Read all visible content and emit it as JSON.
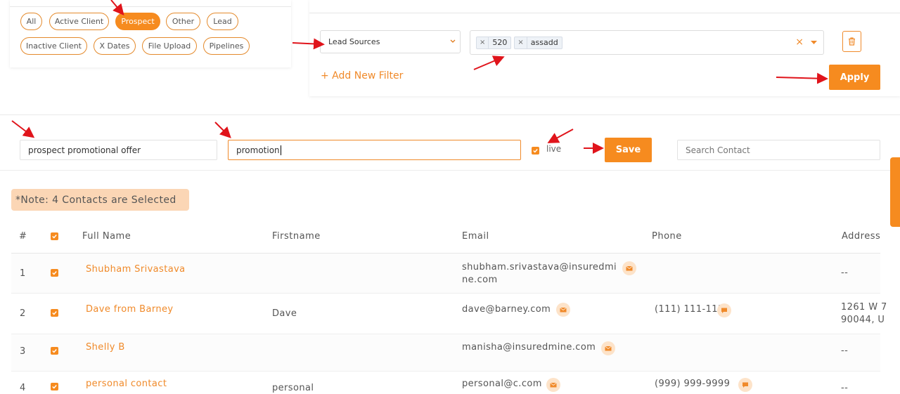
{
  "chips": [
    "All",
    "Active Client",
    "Prospect",
    "Other",
    "Lead",
    "Inactive Client",
    "X Dates",
    "File Upload",
    "Pipelines"
  ],
  "filter": {
    "field_label": "Lead Sources",
    "tags": [
      "520",
      "assadd"
    ],
    "tag_remove_glyph": "×",
    "clear_glyph": "×",
    "add_filter_label": "+ Add New Filter",
    "apply_label": "Apply"
  },
  "save_bar": {
    "name_value": "prospect promotional offer",
    "description_value": "promotion",
    "live_label": "live",
    "save_label": "Save",
    "search_placeholder": "Search Contact"
  },
  "note": "*Note: 4 Contacts are Selected",
  "table": {
    "headers": [
      "#",
      "Full Name",
      "Firstname",
      "Email",
      "Phone",
      "Address"
    ],
    "rows": [
      {
        "num": "1",
        "full_name": "Shubham Srivastava",
        "firstname": "",
        "email_line1": "shubham.srivastava@insuredmi",
        "email_line2": "ne.com",
        "phone": "",
        "address_line1": "--",
        "address_line2": ""
      },
      {
        "num": "2",
        "full_name": "Dave from Barney",
        "firstname": "Dave",
        "email_line1": "dave@barney.com",
        "email_line2": "",
        "phone": "(111) 111-1111",
        "address_line1": "1261 W 7",
        "address_line2": "90044, U"
      },
      {
        "num": "3",
        "full_name": "Shelly B",
        "firstname": "",
        "email_line1": "manisha@insuredmine.com",
        "email_line2": "",
        "phone": "",
        "address_line1": "--",
        "address_line2": ""
      },
      {
        "num": "4",
        "full_name": "personal contact",
        "firstname": "personal",
        "email_line1": "personal@c.com",
        "email_line2": "",
        "phone": "(999) 999-9999",
        "address_line1": "--",
        "address_line2": ""
      }
    ]
  },
  "colors": {
    "accent": "#f68b1f",
    "note_bg": "#fbd6b5",
    "annotation_arrow": "#e0141b"
  },
  "icons": [
    "caret-down-icon",
    "trash-icon",
    "check-icon",
    "mail-icon",
    "chat-icon"
  ]
}
